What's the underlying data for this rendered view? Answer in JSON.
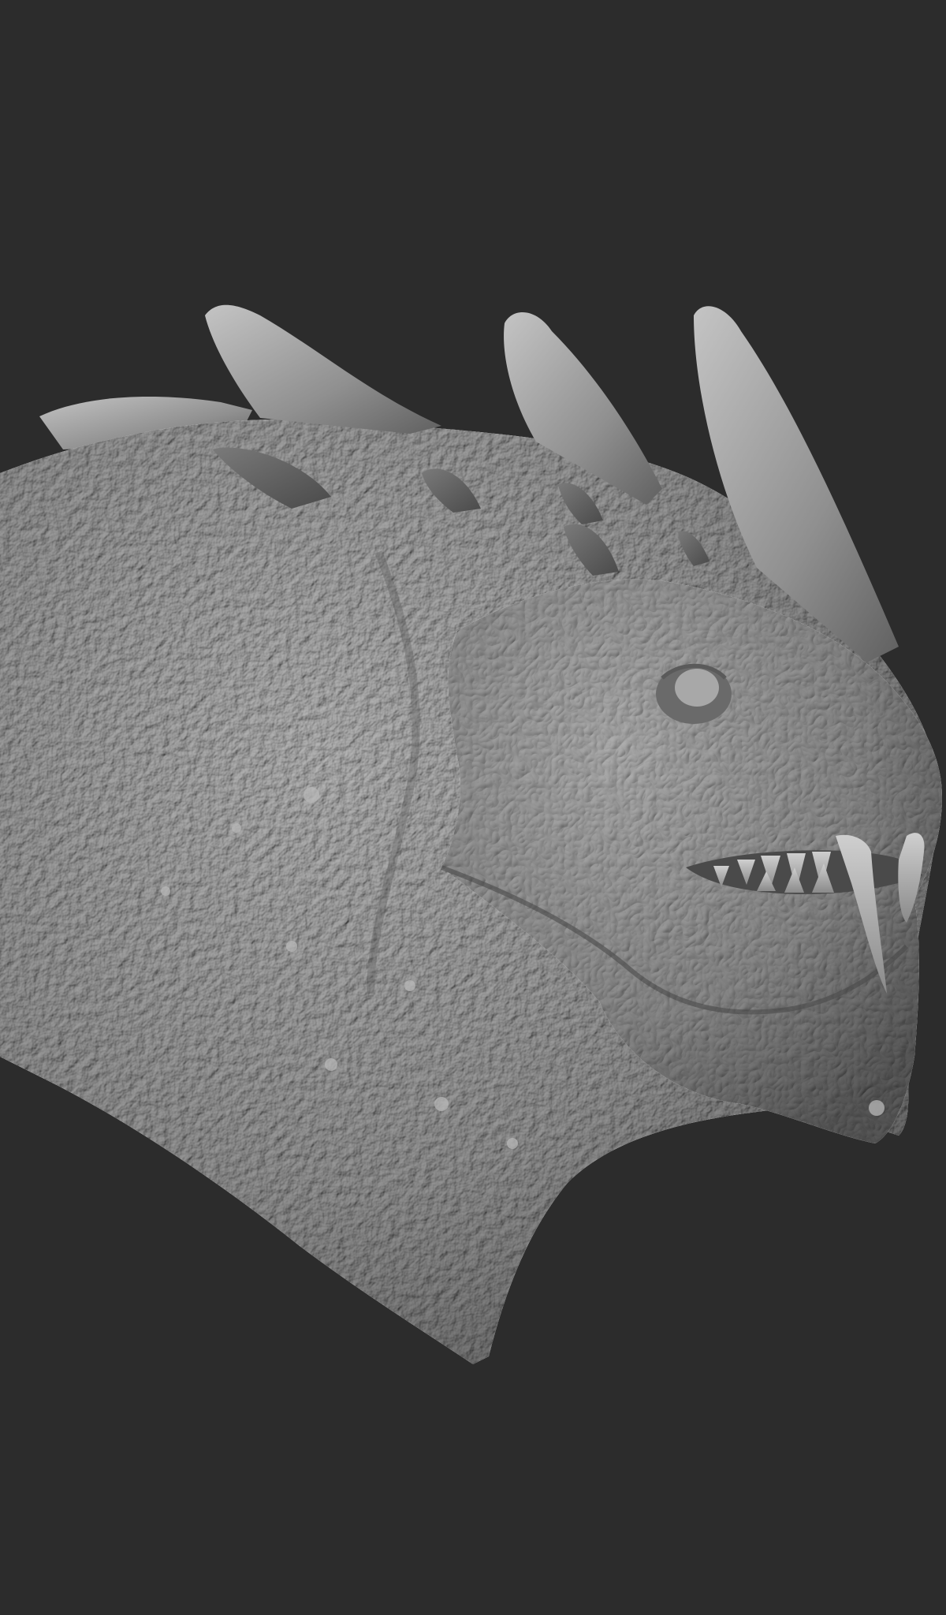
{
  "viewport": {
    "background_color": "#2c2c2c"
  },
  "subject": {
    "material_color": "#8e8e8e",
    "highlight_color": "#b4b4b4",
    "shadow_color": "#565656"
  }
}
